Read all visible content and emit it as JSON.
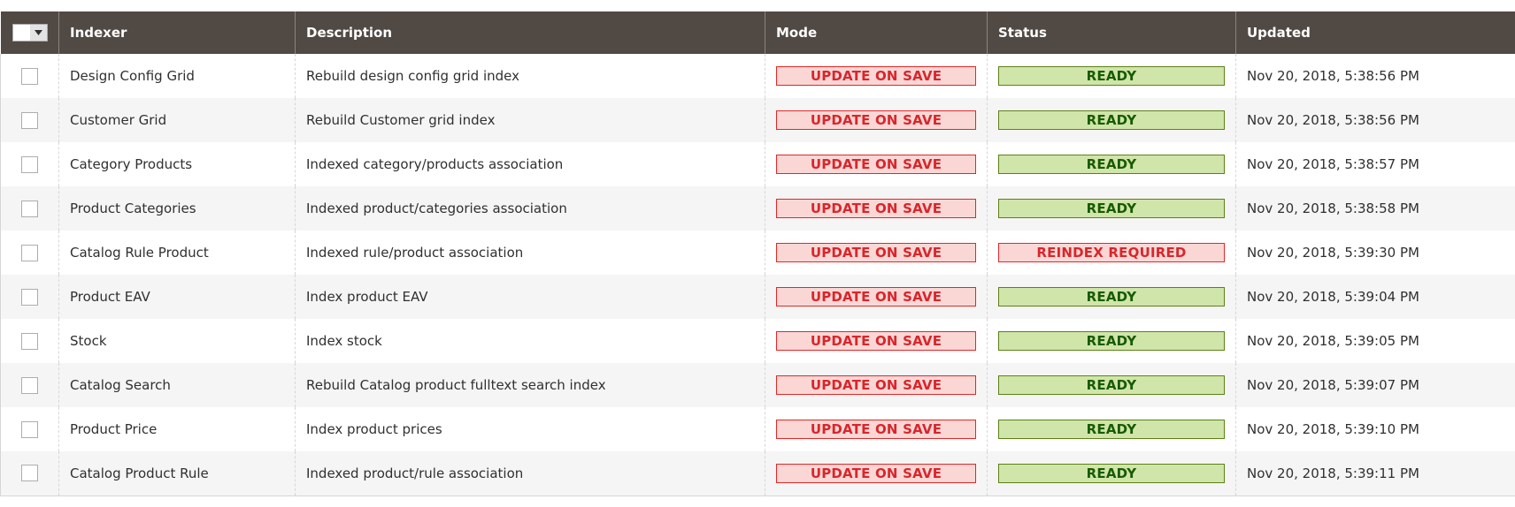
{
  "grid": {
    "columns": {
      "indexer": "Indexer",
      "description": "Description",
      "mode": "Mode",
      "status": "Status",
      "updated": "Updated"
    },
    "mass_select_icon": "chevron-down-icon",
    "colors": {
      "header_bg": "#514943",
      "mode_badge_bg": "#fad7d5",
      "mode_badge_text": "#d8262c",
      "status_ready_bg": "#d0e5a9",
      "status_ready_text": "#185b00",
      "status_reindex_bg": "#fad7d5",
      "status_reindex_text": "#d8262c"
    },
    "rows": [
      {
        "indexer": "Design Config Grid",
        "description": "Rebuild design config grid index",
        "mode": "UPDATE ON SAVE",
        "status": "READY",
        "status_type": "green",
        "updated": "Nov 20, 2018, 5:38:56 PM",
        "checked": false
      },
      {
        "indexer": "Customer Grid",
        "description": "Rebuild Customer grid index",
        "mode": "UPDATE ON SAVE",
        "status": "READY",
        "status_type": "green",
        "updated": "Nov 20, 2018, 5:38:56 PM",
        "checked": false
      },
      {
        "indexer": "Category Products",
        "description": "Indexed category/products association",
        "mode": "UPDATE ON SAVE",
        "status": "READY",
        "status_type": "green",
        "updated": "Nov 20, 2018, 5:38:57 PM",
        "checked": false
      },
      {
        "indexer": "Product Categories",
        "description": "Indexed product/categories association",
        "mode": "UPDATE ON SAVE",
        "status": "READY",
        "status_type": "green",
        "updated": "Nov 20, 2018, 5:38:58 PM",
        "checked": false
      },
      {
        "indexer": "Catalog Rule Product",
        "description": "Indexed rule/product association",
        "mode": "UPDATE ON SAVE",
        "status": "REINDEX REQUIRED",
        "status_type": "red",
        "updated": "Nov 20, 2018, 5:39:30 PM",
        "checked": false
      },
      {
        "indexer": "Product EAV",
        "description": "Index product EAV",
        "mode": "UPDATE ON SAVE",
        "status": "READY",
        "status_type": "green",
        "updated": "Nov 20, 2018, 5:39:04 PM",
        "checked": false
      },
      {
        "indexer": "Stock",
        "description": "Index stock",
        "mode": "UPDATE ON SAVE",
        "status": "READY",
        "status_type": "green",
        "updated": "Nov 20, 2018, 5:39:05 PM",
        "checked": false
      },
      {
        "indexer": "Catalog Search",
        "description": "Rebuild Catalog product fulltext search index",
        "mode": "UPDATE ON SAVE",
        "status": "READY",
        "status_type": "green",
        "updated": "Nov 20, 2018, 5:39:07 PM",
        "checked": false
      },
      {
        "indexer": "Product Price",
        "description": "Index product prices",
        "mode": "UPDATE ON SAVE",
        "status": "READY",
        "status_type": "green",
        "updated": "Nov 20, 2018, 5:39:10 PM",
        "checked": false
      },
      {
        "indexer": "Catalog Product Rule",
        "description": "Indexed product/rule association",
        "mode": "UPDATE ON SAVE",
        "status": "READY",
        "status_type": "green",
        "updated": "Nov 20, 2018, 5:39:11 PM",
        "checked": false
      }
    ]
  }
}
